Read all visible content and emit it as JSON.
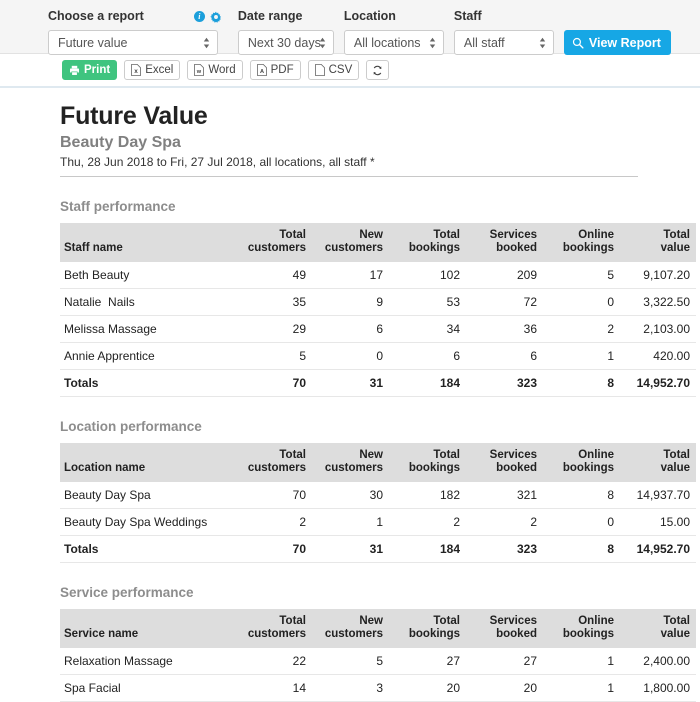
{
  "filters": {
    "report": {
      "label": "Choose a report",
      "value": "Future value",
      "info_icon": "info-circle-icon",
      "gear_icon": "gear-icon"
    },
    "date_range": {
      "label": "Date range",
      "value": "Next 30 days"
    },
    "location": {
      "label": "Location",
      "value": "All locations"
    },
    "staff": {
      "label": "Staff",
      "value": "All staff"
    },
    "view_report_label": "View Report",
    "view_report_icon": "magnifier-icon",
    "accent_blue": "#16a7e5"
  },
  "export_bar": {
    "buttons": [
      {
        "label": "Print",
        "icon": "printer-icon"
      },
      {
        "label": "Excel",
        "icon": "excel-file-icon"
      },
      {
        "label": "Word",
        "icon": "word-file-icon"
      },
      {
        "label": "PDF",
        "icon": "pdf-file-icon"
      },
      {
        "label": "CSV",
        "icon": "csv-file-icon"
      }
    ],
    "refresh_icon": "refresh-icon",
    "print_green": "#3fc47f"
  },
  "report": {
    "title": "Future Value",
    "subtitle": "Beauty Day Spa",
    "meta": "Thu, 28 Jun 2018 to Fri, 27 Jul 2018, all locations, all staff *"
  },
  "common_columns": [
    "Total customers",
    "New customers",
    "Total bookings",
    "Services booked",
    "Online bookings",
    "Total value"
  ],
  "column_lines": {
    "total_customers": [
      "Total",
      "customers"
    ],
    "new_customers": [
      "New",
      "customers"
    ],
    "total_bookings": [
      "Total",
      "bookings"
    ],
    "services_booked": [
      "Services",
      "booked"
    ],
    "online_bookings": [
      "Online",
      "bookings"
    ],
    "total_value": [
      "Total",
      "value"
    ]
  },
  "sections": [
    {
      "title": "Staff performance",
      "name_header": "Staff name",
      "rows": [
        {
          "name": "Beth Beauty",
          "values": [
            "49",
            "17",
            "102",
            "209",
            "5",
            "9,107.20"
          ]
        },
        {
          "name": "Natalie  Nails",
          "values": [
            "35",
            "9",
            "53",
            "72",
            "0",
            "3,322.50"
          ]
        },
        {
          "name": "Melissa Massage",
          "values": [
            "29",
            "6",
            "34",
            "36",
            "2",
            "2,103.00"
          ]
        },
        {
          "name": "Annie Apprentice",
          "values": [
            "5",
            "0",
            "6",
            "6",
            "1",
            "420.00"
          ]
        }
      ],
      "totals": {
        "name": "Totals",
        "values": [
          "70",
          "31",
          "184",
          "323",
          "8",
          "14,952.70"
        ]
      }
    },
    {
      "title": "Location performance",
      "name_header": "Location name",
      "rows": [
        {
          "name": "Beauty Day Spa",
          "values": [
            "70",
            "30",
            "182",
            "321",
            "8",
            "14,937.70"
          ]
        },
        {
          "name": "Beauty Day Spa Weddings",
          "values": [
            "2",
            "1",
            "2",
            "2",
            "0",
            "15.00"
          ]
        }
      ],
      "totals": {
        "name": "Totals",
        "values": [
          "70",
          "31",
          "184",
          "323",
          "8",
          "14,952.70"
        ]
      }
    },
    {
      "title": "Service performance",
      "name_header": "Service name",
      "rows": [
        {
          "name": "Relaxation Massage",
          "values": [
            "22",
            "5",
            "27",
            "27",
            "1",
            "2,400.00"
          ]
        },
        {
          "name": "Spa Facial",
          "values": [
            "14",
            "3",
            "20",
            "20",
            "1",
            "1,800.00"
          ]
        }
      ],
      "totals": null
    }
  ]
}
